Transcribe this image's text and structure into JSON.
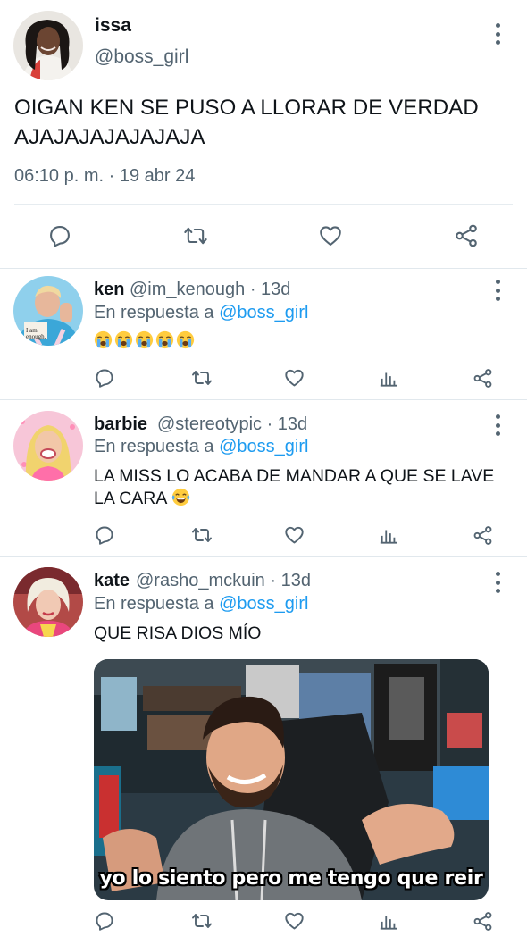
{
  "main_tweet": {
    "name": "issa",
    "handle": "@boss_girl",
    "text": "OIGAN KEN SE PUSO A LLORAR DE VERDAD AJAJAJAJAJAJAJA",
    "timestamp": "06:10 p. m. · 19 abr 24",
    "avatar_icon": "profile-photo"
  },
  "replies": [
    {
      "name": "ken",
      "handle": "@im_kenough · 13d",
      "reply_prefix": "En respuesta a",
      "reply_target": "@boss_girl",
      "text": "",
      "emoji": [
        "loudly-crying-face",
        "loudly-crying-face",
        "loudly-crying-face",
        "loudly-crying-face",
        "loudly-crying-face"
      ]
    },
    {
      "name": "barbie",
      "handle": "@stereotypic · 13d",
      "reply_prefix": "En respuesta a",
      "reply_target": "@boss_girl",
      "text": "LA MISS LO ACABA DE MANDAR A QUE SE LAVE LA CARA",
      "emoji": [
        "face-with-tears-of-joy"
      ]
    },
    {
      "name": "kate",
      "handle": "@rasho_mckuin · 13d",
      "reply_prefix": "En respuesta a",
      "reply_target": "@boss_girl",
      "text": "QUE RISA DIOS MÍO",
      "media_caption": "yo lo siento pero me tengo que reir"
    }
  ],
  "colors": {
    "text": "#0f1419",
    "secondary": "#536471",
    "link": "#1d9bf0",
    "divider": "#e1e8ed"
  }
}
